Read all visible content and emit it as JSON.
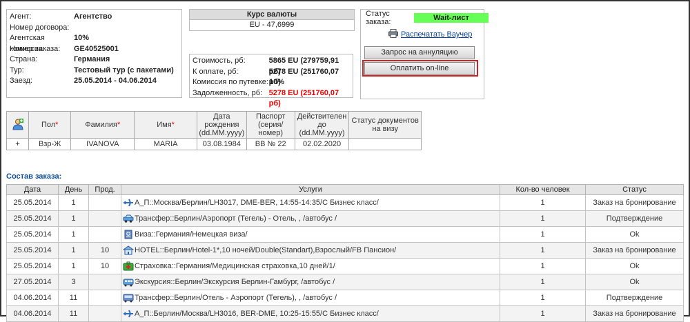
{
  "agent_info": {
    "rows": [
      {
        "label": "Агент:",
        "value": "Агентство"
      },
      {
        "label": "Номер договора:",
        "value": ""
      },
      {
        "label": "Агентская комиссия:",
        "value": "10%"
      },
      {
        "label": "Номер заказа:",
        "value": "GE40525001"
      },
      {
        "label": "Страна:",
        "value": "Германия"
      },
      {
        "label": "Тур:",
        "value": "Тестовый тур (с пакетами)"
      },
      {
        "label": "Заезд:",
        "value": "25.05.2014  -  04.06.2014"
      }
    ]
  },
  "currency": {
    "title": "Курс валюты",
    "value": "EU - 47,6999"
  },
  "finance": {
    "rows": [
      {
        "label": "Стоимость, рб:",
        "value": "5865 EU (279759,91 рб)"
      },
      {
        "label": "К оплате, рб:",
        "value": "5278 EU (251760,07 рб)"
      },
      {
        "label": "Комиссия по путевке:",
        "value": "10%"
      },
      {
        "label": "Задолженность, рб:",
        "value": "5278 EU (251760,07 рб)"
      }
    ]
  },
  "order_status": {
    "label": "Статус заказа:",
    "value": "Wait-лист",
    "print_voucher": "Распечатать Ваучер",
    "cancel_request": "Запрос на аннуляцию",
    "pay_online": "Оплатить on-line"
  },
  "tourists": {
    "columns": [
      "Пол",
      "Фамилия",
      "Имя",
      "Дата рождения (dd.MM.yyyy)",
      "Паспорт (серия/номер)",
      "Действителен до (dd.MM.yyyy)",
      "Статус документов на визу"
    ],
    "rows": [
      {
        "add": "+",
        "sex": "Взр-Ж",
        "surname": "IVANOVA",
        "name": "MARIA",
        "birth": "03.08.1984",
        "passport": "BB № 22",
        "valid": "02.02.2020",
        "visa": ""
      }
    ]
  },
  "order": {
    "title": "Состав заказа:",
    "columns": [
      "Дата",
      "День",
      "Прод.",
      "Услуги",
      "Кол-во человек",
      "Статус"
    ],
    "rows": [
      {
        "date": "25.05.2014",
        "day": "1",
        "prod": "",
        "icon": "airplane-icon",
        "service": "А_П::Москва/Берлин/LH3017, DME-BER, 14:55-14:35/С Бизнес класс/",
        "persons": "1",
        "status": "Заказ на бронирование"
      },
      {
        "date": "25.05.2014",
        "day": "1",
        "prod": "",
        "icon": "car-icon",
        "service": "Трансфер::Берлин/Аэропорт (Тегель) - Отель, , /автобус /",
        "persons": "1",
        "status": "Подтверждение"
      },
      {
        "date": "25.05.2014",
        "day": "1",
        "prod": "",
        "icon": "passport-icon",
        "service": "Виза::Германия/Немецкая виза/",
        "persons": "1",
        "status": "Ok"
      },
      {
        "date": "25.05.2014",
        "day": "1",
        "prod": "10",
        "icon": "hotel-icon",
        "service": "HOTEL::Берлин/Hotel-1*,10 ночей/Double(Standart),Взрослый/FB Пансион/",
        "persons": "1",
        "status": "Заказ на бронирование"
      },
      {
        "date": "25.05.2014",
        "day": "1",
        "prod": "10",
        "icon": "medical-insurance-icon",
        "service": "Страховка::Германия/Медицинская страховка,10 дней/1/",
        "persons": "1",
        "status": "Ok"
      },
      {
        "date": "27.05.2014",
        "day": "3",
        "prod": "",
        "icon": "excursion-icon",
        "service": "Экскурсия::Берлин/Экскурсия Берлин-Гамбург, /автобус /",
        "persons": "1",
        "status": "Ok"
      },
      {
        "date": "04.06.2014",
        "day": "11",
        "prod": "",
        "icon": "bus-icon",
        "service": "Трансфер::Берлин/Отель - Аэропорт (Тегель), , /автобус /",
        "persons": "1",
        "status": "Подтверждение"
      },
      {
        "date": "04.06.2014",
        "day": "11",
        "prod": "",
        "icon": "airplane-icon",
        "service": "А_П::Берлин/Москва/LH3016, BER-DME, 10:25-15:55/С Бизнес класс/",
        "persons": "1",
        "status": "Заказ на бронирование"
      }
    ]
  }
}
